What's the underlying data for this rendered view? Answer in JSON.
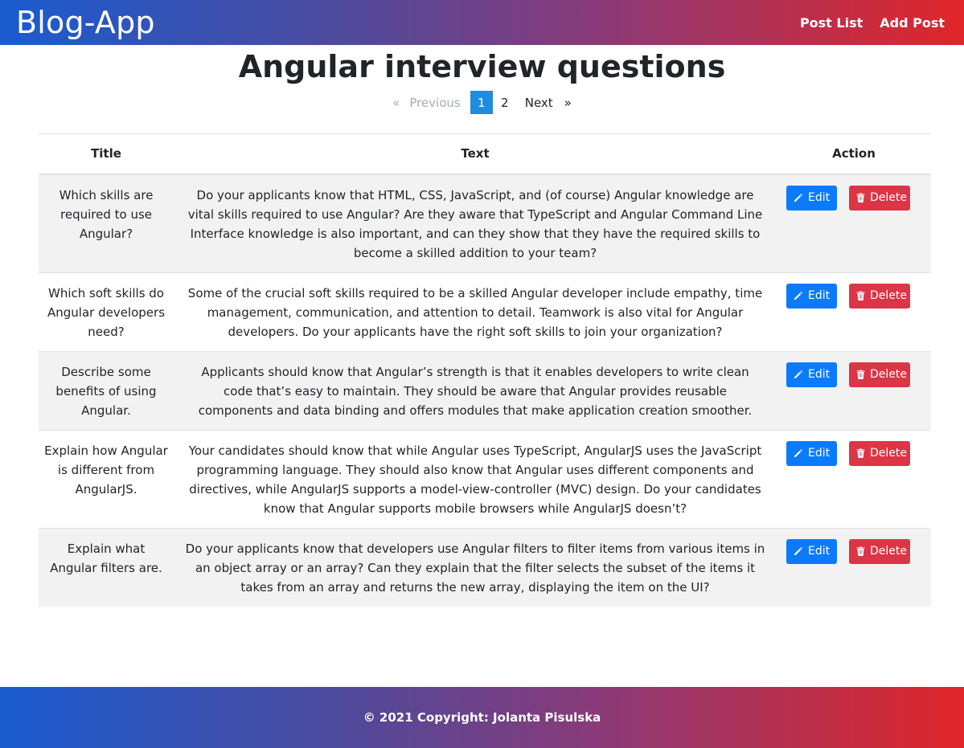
{
  "navbar": {
    "brand": "Blog-App",
    "links": [
      "Post List",
      "Add Post"
    ]
  },
  "page_title": "Angular interview questions",
  "pagination": {
    "prev_arrow": "«",
    "prev_label": "Previous",
    "pages": [
      "1",
      "2"
    ],
    "current": "1",
    "next_label": "Next",
    "next_arrow": "»"
  },
  "table": {
    "headers": [
      "Title",
      "Text",
      "Action"
    ],
    "edit_label": "Edit",
    "delete_label": "Delete",
    "rows": [
      {
        "title": "Which skills are required to use Angular?",
        "text": "Do your applicants know that HTML, CSS, JavaScript, and (of course) Angular knowledge are vital skills required to use Angular? Are they aware that TypeScript and Angular Command Line Interface knowledge is also important, and can they show that they have the required skills to become a skilled addition to your team?"
      },
      {
        "title": "Which soft skills do Angular developers need?",
        "text": "Some of the crucial soft skills required to be a skilled Angular developer include empathy, time management, communication, and attention to detail. Teamwork is also vital for Angular developers. Do your applicants have the right soft skills to join your organization?"
      },
      {
        "title": "Describe some benefits of using Angular.",
        "text": "Applicants should know that Angular’s strength is that it enables developers to write clean code that’s easy to maintain. They should be aware that Angular provides reusable components and data binding and offers modules that make application creation smoother."
      },
      {
        "title": "Explain how Angular is different from AngularJS.",
        "text": "Your candidates should know that while Angular uses TypeScript, AngularJS uses the JavaScript programming language. They should also know that Angular uses different components and directives, while AngularJS supports a model-view-controller (MVC) design. Do your candidates know that Angular supports mobile browsers while AngularJS doesn’t?"
      },
      {
        "title": "Explain what Angular filters are.",
        "text": "Do your applicants know that developers use Angular filters to filter items from various items in an object array or an array? Can they explain that the filter selects the subset of the items it takes from an array and returns the new array, displaying the item on the UI?"
      }
    ]
  },
  "footer": {
    "text": "© 2021 Copyright: Jolanta Pisulska"
  },
  "icons": {
    "edit": "pencil-icon",
    "delete": "trash-icon"
  },
  "colors": {
    "edit_button": "#0b7bfb",
    "delete_button": "#dc3545",
    "active_page": "#1f8ce0",
    "gradient_start": "#1a5bd0",
    "gradient_end": "#e0262a"
  }
}
